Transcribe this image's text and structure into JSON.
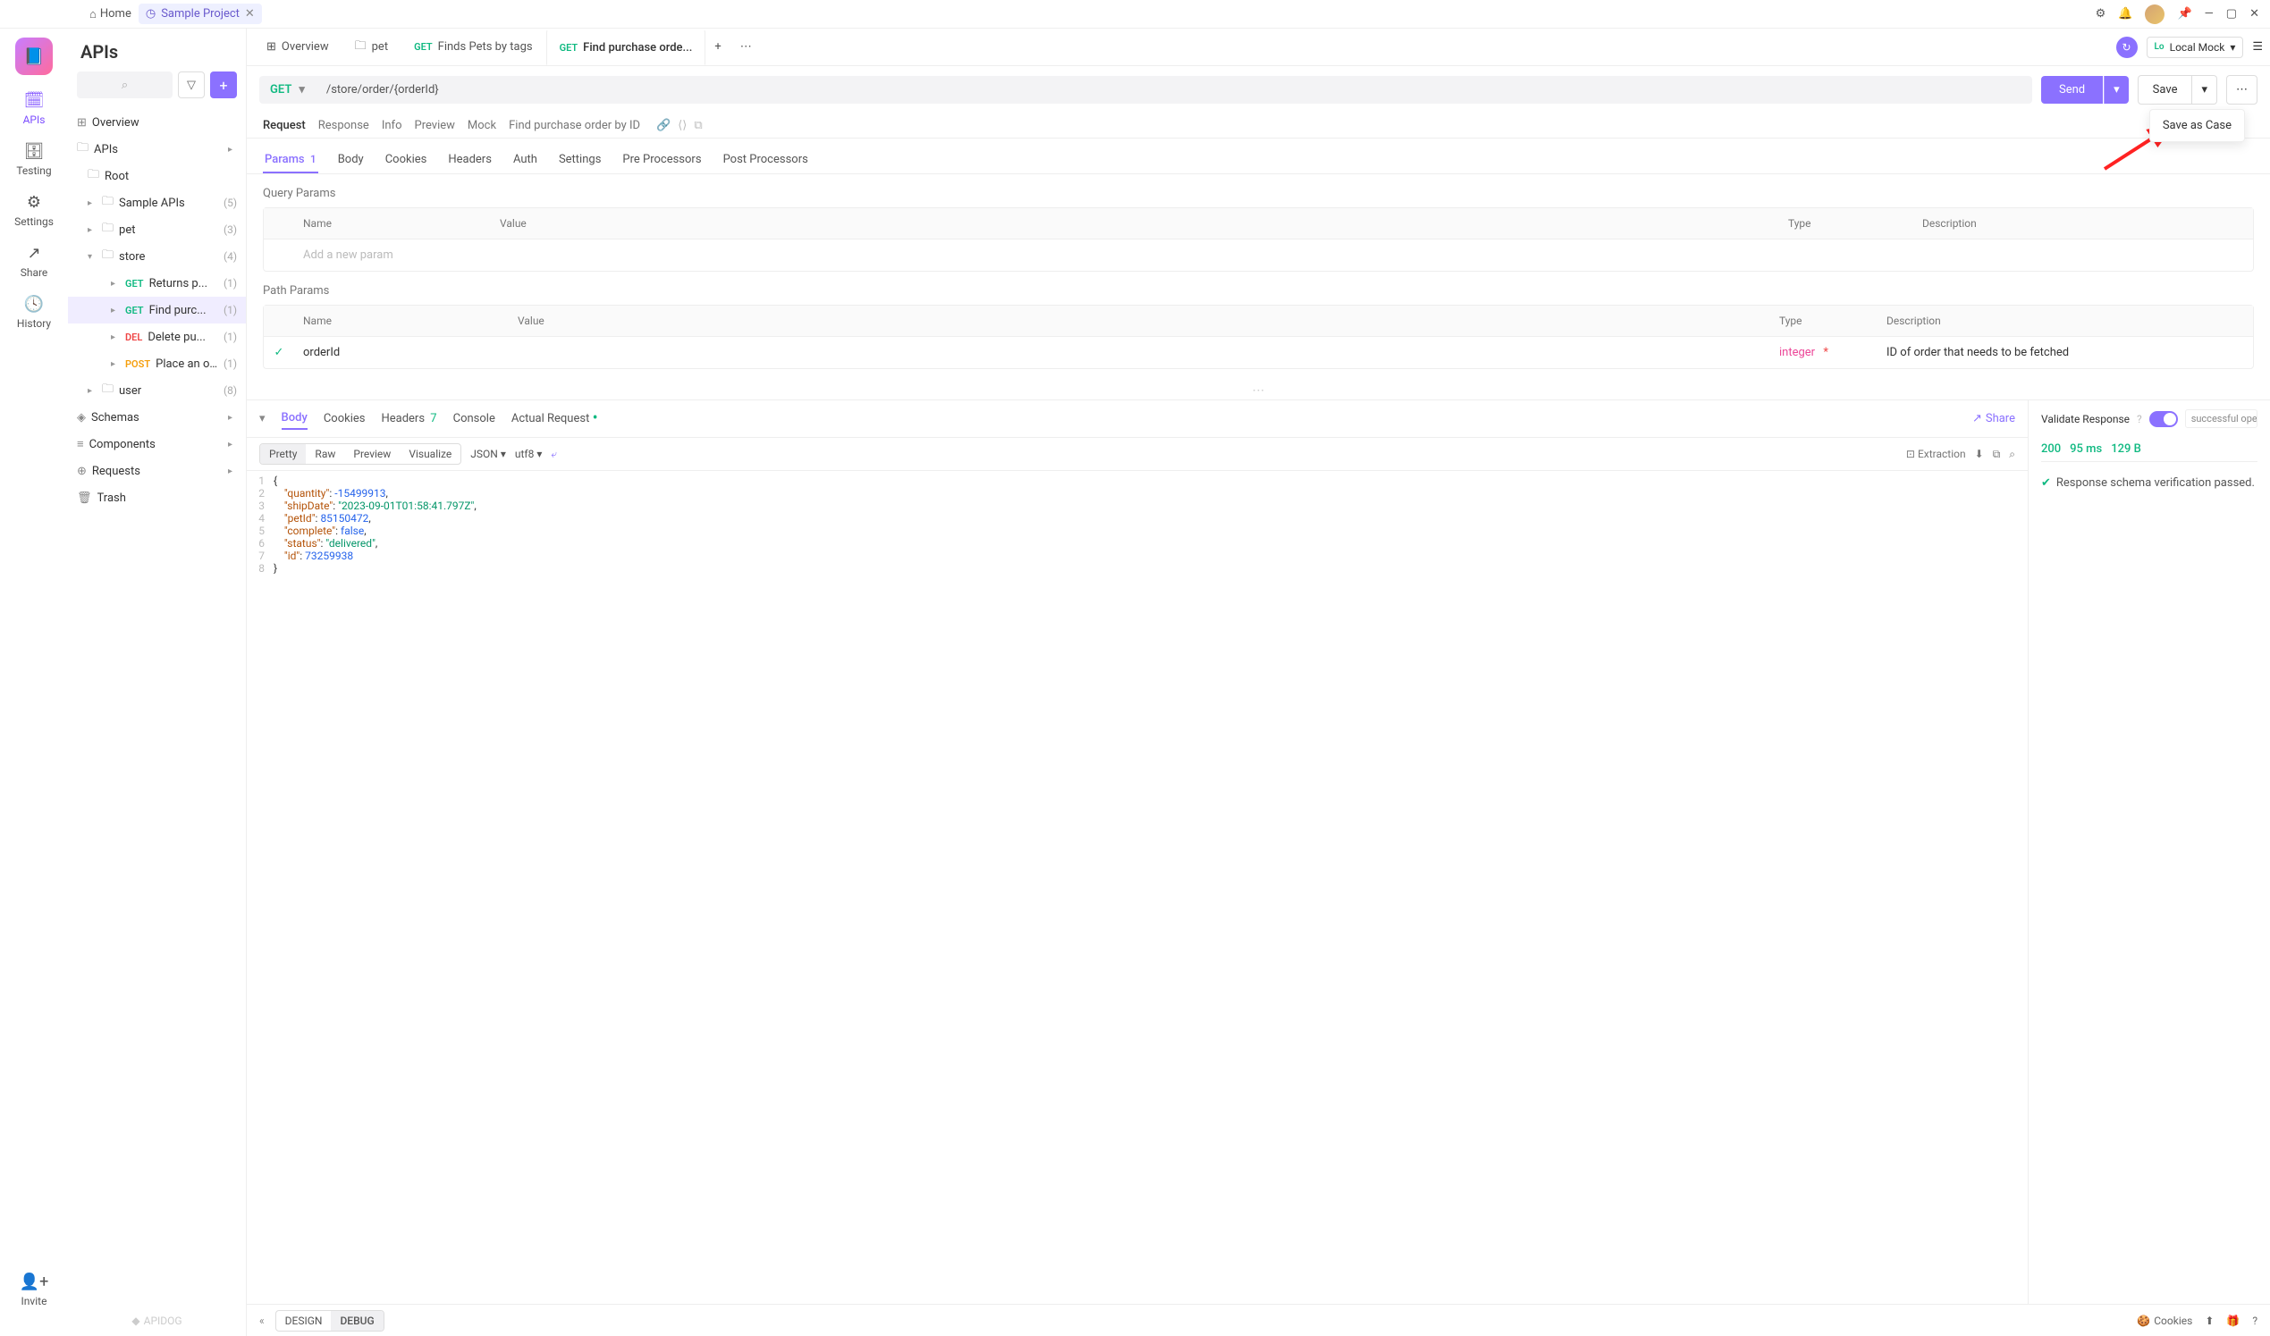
{
  "titlebar": {
    "home": "Home",
    "project": "Sample Project"
  },
  "rail": {
    "apis": "APIs",
    "testing": "Testing",
    "settings": "Settings",
    "share": "Share",
    "history": "History",
    "invite": "Invite"
  },
  "sidebar": {
    "title": "APIs",
    "overview": "Overview",
    "apis_label": "APIs",
    "root": "Root",
    "tree": [
      {
        "label": "Sample APIs",
        "count": "(5)"
      },
      {
        "label": "pet",
        "count": "(3)"
      },
      {
        "label": "store",
        "count": "(4)"
      }
    ],
    "store_items": [
      {
        "method": "GET",
        "label": "Returns p...",
        "count": "(1)"
      },
      {
        "method": "GET",
        "label": "Find purc...",
        "count": "(1)",
        "selected": true
      },
      {
        "method": "DEL",
        "label": "Delete pu...",
        "count": "(1)"
      },
      {
        "method": "POST",
        "label": "Place an o...",
        "count": "(1)"
      }
    ],
    "user": {
      "label": "user",
      "count": "(8)"
    },
    "schemas": "Schemas",
    "components": "Components",
    "requests": "Requests",
    "trash": "Trash",
    "brand": "APIDOG"
  },
  "tabs": [
    {
      "icon": "overview",
      "label": "Overview"
    },
    {
      "icon": "folder",
      "label": "pet"
    },
    {
      "method": "GET",
      "label": "Finds Pets by tags"
    },
    {
      "method": "GET",
      "label": "Find purchase orde...",
      "active": true
    }
  ],
  "env": {
    "tag": "Lo",
    "label": "Local Mock"
  },
  "request": {
    "method": "GET",
    "url": "/store/order/{orderId}",
    "send": "Send",
    "save": "Save",
    "save_as_case": "Save as Case"
  },
  "breadcrumb": {
    "items": [
      "Request",
      "Response",
      "Info",
      "Preview",
      "Mock",
      "Find purchase order by ID"
    ]
  },
  "param_tabs": [
    {
      "label": "Params",
      "badge": "1",
      "active": true
    },
    {
      "label": "Body"
    },
    {
      "label": "Cookies"
    },
    {
      "label": "Headers"
    },
    {
      "label": "Auth"
    },
    {
      "label": "Settings"
    },
    {
      "label": "Pre Processors"
    },
    {
      "label": "Post Processors"
    }
  ],
  "query_params": {
    "title": "Query Params",
    "headers": {
      "name": "Name",
      "value": "Value",
      "type": "Type",
      "desc": "Description"
    },
    "placeholder": "Add a new param"
  },
  "path_params": {
    "title": "Path Params",
    "headers": {
      "name": "Name",
      "value": "Value",
      "type": "Type",
      "desc": "Description"
    },
    "rows": [
      {
        "name": "orderId",
        "value": "",
        "type": "integer",
        "required": true,
        "desc": "ID of order that needs to be fetched"
      }
    ]
  },
  "response_tabs": {
    "body": "Body",
    "cookies": "Cookies",
    "headers": "Headers",
    "headers_count": "7",
    "console": "Console",
    "actual": "Actual Request",
    "share": "Share"
  },
  "response_toolbar": {
    "modes": [
      "Pretty",
      "Raw",
      "Preview",
      "Visualize"
    ],
    "format": "JSON",
    "encoding": "utf8",
    "extraction": "Extraction"
  },
  "response_body": {
    "quantity": -15499913,
    "shipDate": "2023-09-01T01:58:41.797Z",
    "petId": 85150472,
    "complete": false,
    "status": "delivered",
    "id": 73259938
  },
  "response_side": {
    "validate": "Validate Response",
    "schema": "successful oper...",
    "status": "200",
    "time": "95 ms",
    "size": "129 B",
    "verify": "Response schema verification passed."
  },
  "footer": {
    "design": "DESIGN",
    "debug": "DEBUG",
    "cookies": "Cookies"
  }
}
